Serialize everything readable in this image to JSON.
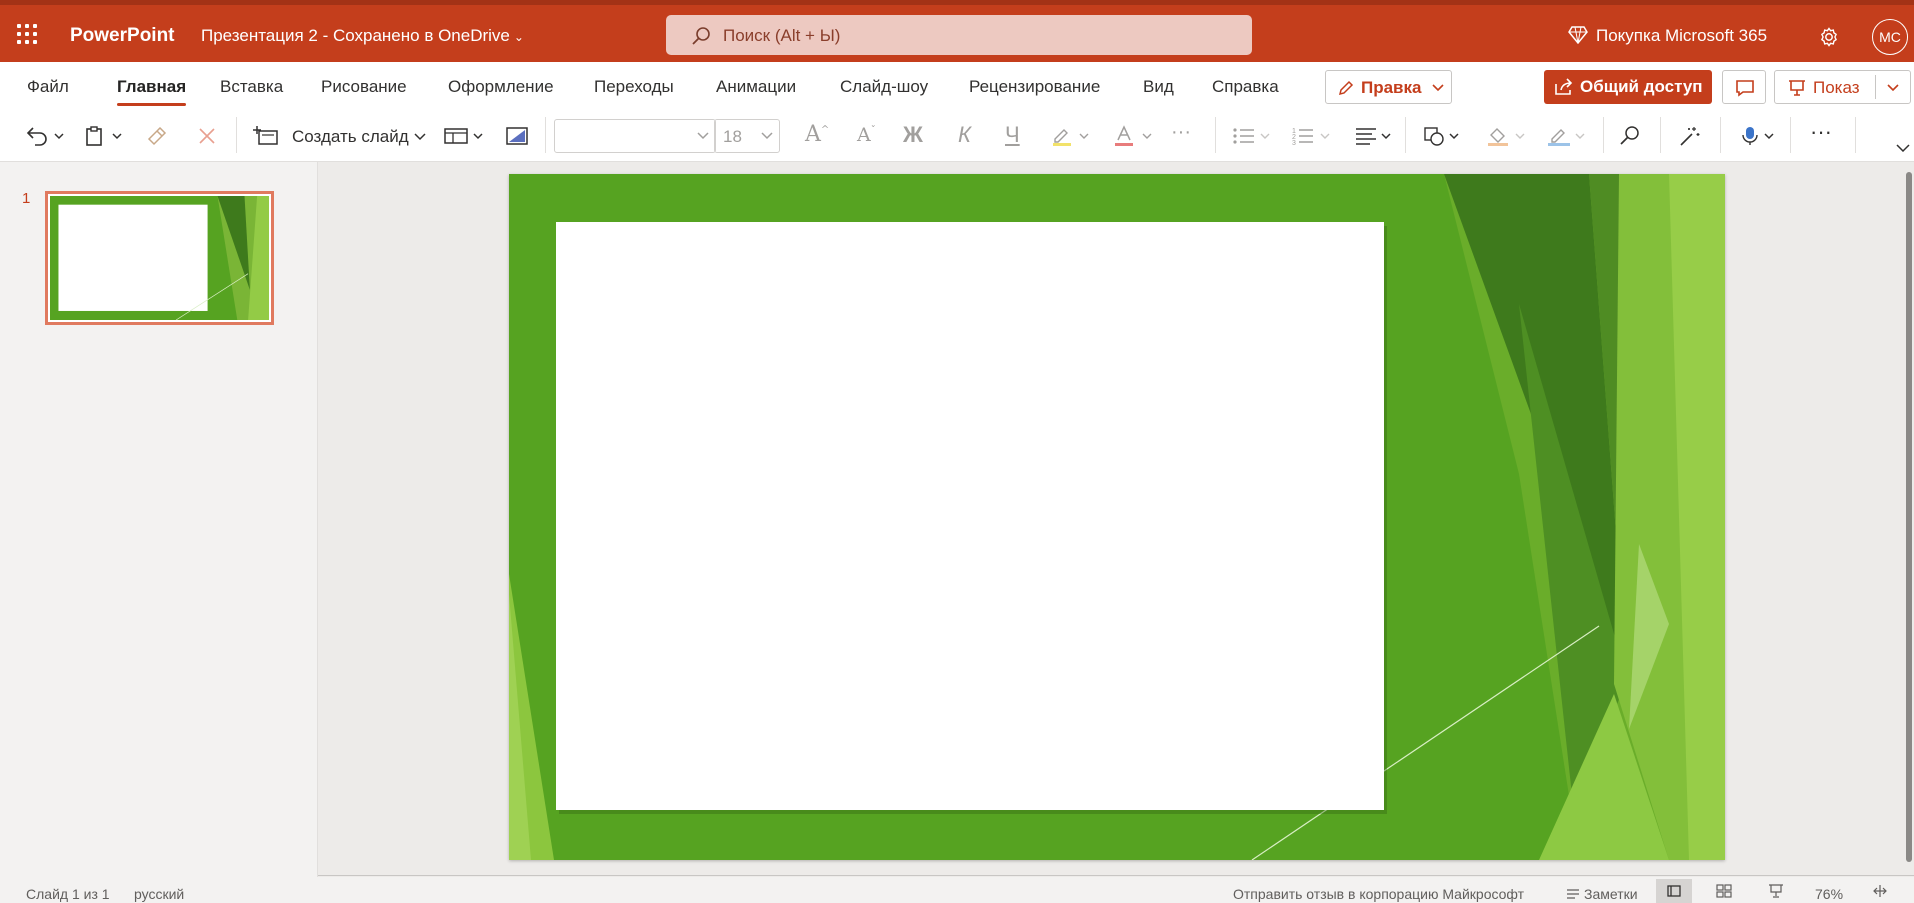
{
  "titlebar": {
    "app_name": "PowerPoint",
    "doc_title": "Презентация 2  -  Сохранено в OneDrive",
    "search_placeholder": "Поиск (Alt + Ы)",
    "premium": "Покупка Microsoft 365",
    "avatar_initials": "МС"
  },
  "tabs": [
    {
      "label": "Файл",
      "active": false
    },
    {
      "label": "Главная",
      "active": true
    },
    {
      "label": "Вставка",
      "active": false
    },
    {
      "label": "Рисование",
      "active": false
    },
    {
      "label": "Оформление",
      "active": false
    },
    {
      "label": "Переходы",
      "active": false
    },
    {
      "label": "Анимации",
      "active": false
    },
    {
      "label": "Слайд-шоу",
      "active": false
    },
    {
      "label": "Рецензирование",
      "active": false
    },
    {
      "label": "Вид",
      "active": false
    },
    {
      "label": "Справка",
      "active": false
    }
  ],
  "actions": {
    "edit": "Правка",
    "share": "Общий доступ",
    "present": "Показ"
  },
  "toolbar": {
    "new_slide": "Создать слайд",
    "font_name": "",
    "font_size": "18",
    "grow_font": "A",
    "shrink_font": "A",
    "bold": "Ж",
    "italic": "К",
    "underline": "Ч"
  },
  "slides": {
    "count": 1,
    "current": 1,
    "thumb_number": "1"
  },
  "statusbar": {
    "slide_info": "Слайд 1 из 1",
    "language": "русский",
    "feedback": "Отправить отзыв в корпорацию Майкрософт",
    "notes": "Заметки",
    "zoom": "76%"
  },
  "colors": {
    "accent": "#c43e1c",
    "slide_green": "#56a321",
    "slide_dark_green": "#3e7a1c",
    "slide_light_green": "#8cc63e"
  }
}
